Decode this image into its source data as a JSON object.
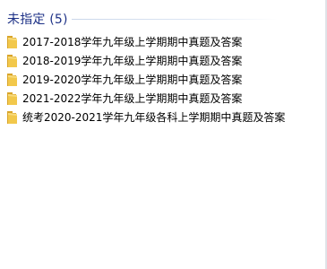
{
  "group": {
    "title": "未指定 (5)"
  },
  "items": [
    {
      "name": "2017-2018学年九年级上学期期中真题及答案",
      "icon": "folder-icon"
    },
    {
      "name": "2018-2019学年九年级上学期期中真题及答案",
      "icon": "folder-icon"
    },
    {
      "name": "2019-2020学年九年级上学期期中真题及答案",
      "icon": "folder-icon"
    },
    {
      "name": "2021-2022学年九年级上学期期中真题及答案",
      "icon": "folder-icon"
    },
    {
      "name": "统考2020-2021学年九年级各科上学期期中真题及答案",
      "icon": "folder-icon"
    }
  ],
  "colors": {
    "group_title": "#1e3287",
    "folder_yellow": "#f2c84b",
    "folder_shadow": "#d9a52a"
  }
}
